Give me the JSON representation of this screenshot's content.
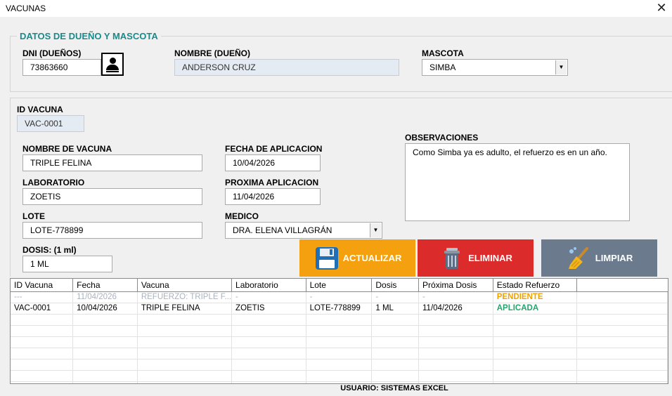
{
  "window": {
    "title": "VACUNAS",
    "close_glyph": "✕"
  },
  "owner_section": {
    "title": "DATOS DE DUEÑO Y MASCOTA",
    "dni_label": "DNI (DUEÑOS)",
    "dni_value": "73863660",
    "owner_name_label": "NOMBRE (DUEÑO)",
    "owner_name_value": "ANDERSON CRUZ",
    "pet_label": "MASCOTA",
    "pet_value": "SIMBA"
  },
  "vaccine_form": {
    "id_label": "ID VACUNA",
    "id_value": "VAC-0001",
    "name_label": "NOMBRE DE VACUNA",
    "name_value": "TRIPLE FELINA",
    "lab_label": "LABORATORIO",
    "lab_value": "ZOETIS",
    "lot_label": "LOTE",
    "lot_value": "LOTE-778899",
    "dose_label": "DOSIS: (1 ml)",
    "dose_value": "1 ML",
    "apply_date_label": "FECHA DE APLICACION",
    "apply_date_value": "10/04/2026",
    "next_date_label": "PROXIMA APLICACION",
    "next_date_value": "11/04/2026",
    "doctor_label": "MEDICO",
    "doctor_value": "DRA. ELENA VILLAGRÁN",
    "obs_label": "OBSERVACIONES",
    "obs_value": "Como Simba ya es adulto, el refuerzo es en un año."
  },
  "actions": {
    "update_label": "ACTUALIZAR",
    "delete_label": "ELIMINAR",
    "clear_label": "LIMPIAR"
  },
  "colors": {
    "accent_teal": "#1b8a8a",
    "update_bg": "#f5a00f",
    "delete_bg": "#dc2b2b",
    "clear_bg": "#6c7a8e",
    "pending": "#f2a100",
    "applied": "#22a66a"
  },
  "table": {
    "columns": [
      "ID Vacuna",
      "Fecha",
      "Vacuna",
      "Laboratorio",
      "Lote",
      "Dosis",
      "Próxima Dosis",
      "Estado Refuerzo"
    ],
    "rows": [
      [
        "---",
        "11/04/2026",
        "REFUERZO: TRIPLE F...",
        "-",
        "-",
        "-",
        "-",
        "PENDIENTE"
      ],
      [
        "VAC-0001",
        "10/04/2026",
        "TRIPLE FELINA",
        "ZOETIS",
        "LOTE-778899",
        "1 ML",
        "11/04/2026",
        "APLICADA"
      ]
    ]
  },
  "footer": {
    "user_label": "USUARIO: SISTEMAS EXCEL"
  }
}
